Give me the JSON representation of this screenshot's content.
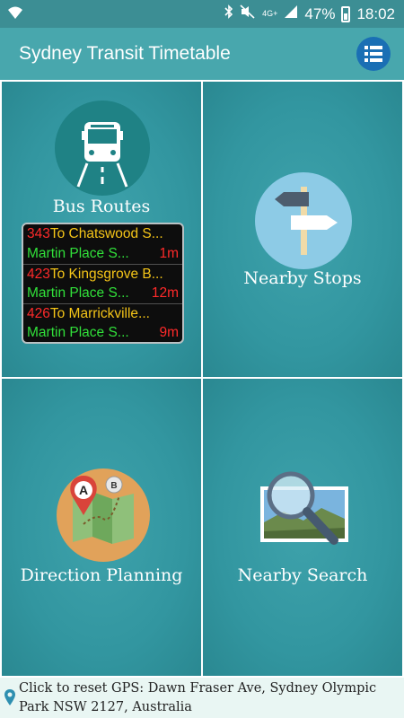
{
  "status_bar": {
    "network": "4G+",
    "battery": "47%",
    "time": "18:02"
  },
  "app_bar": {
    "title": "Sydney Transit Timetable",
    "menu_icon": "list-menu-icon"
  },
  "tiles": {
    "bus_routes": {
      "label": "Bus Routes",
      "icon": "bus-icon"
    },
    "nearby_stops": {
      "label": "Nearby Stops",
      "icon": "signpost-icon"
    },
    "direction_planning": {
      "label": "Direction Planning",
      "icon": "map-route-icon"
    },
    "nearby_search": {
      "label": "Nearby Search",
      "icon": "magnifier-icon"
    }
  },
  "departure_board": [
    {
      "route": "343",
      "destination": "To Chatswood S...",
      "stop": "Martin Place S...",
      "minutes": "1m"
    },
    {
      "route": "423",
      "destination": "To Kingsgrove B...",
      "stop": "Martin Place S...",
      "minutes": "12m"
    },
    {
      "route": "426",
      "destination": "To Marrickville...",
      "stop": "Martin Place S...",
      "minutes": "9m"
    }
  ],
  "gps_bar": {
    "text": "Click to reset GPS: Dawn Fraser Ave, Sydney Olympic Park NSW 2127, Australia"
  },
  "colors": {
    "status_bar": "#3c8e94",
    "app_bar": "#48a7ad",
    "tile": "#3296a0",
    "menu_button": "#1a6fb4",
    "gps_bar": "#e9f6f3"
  }
}
